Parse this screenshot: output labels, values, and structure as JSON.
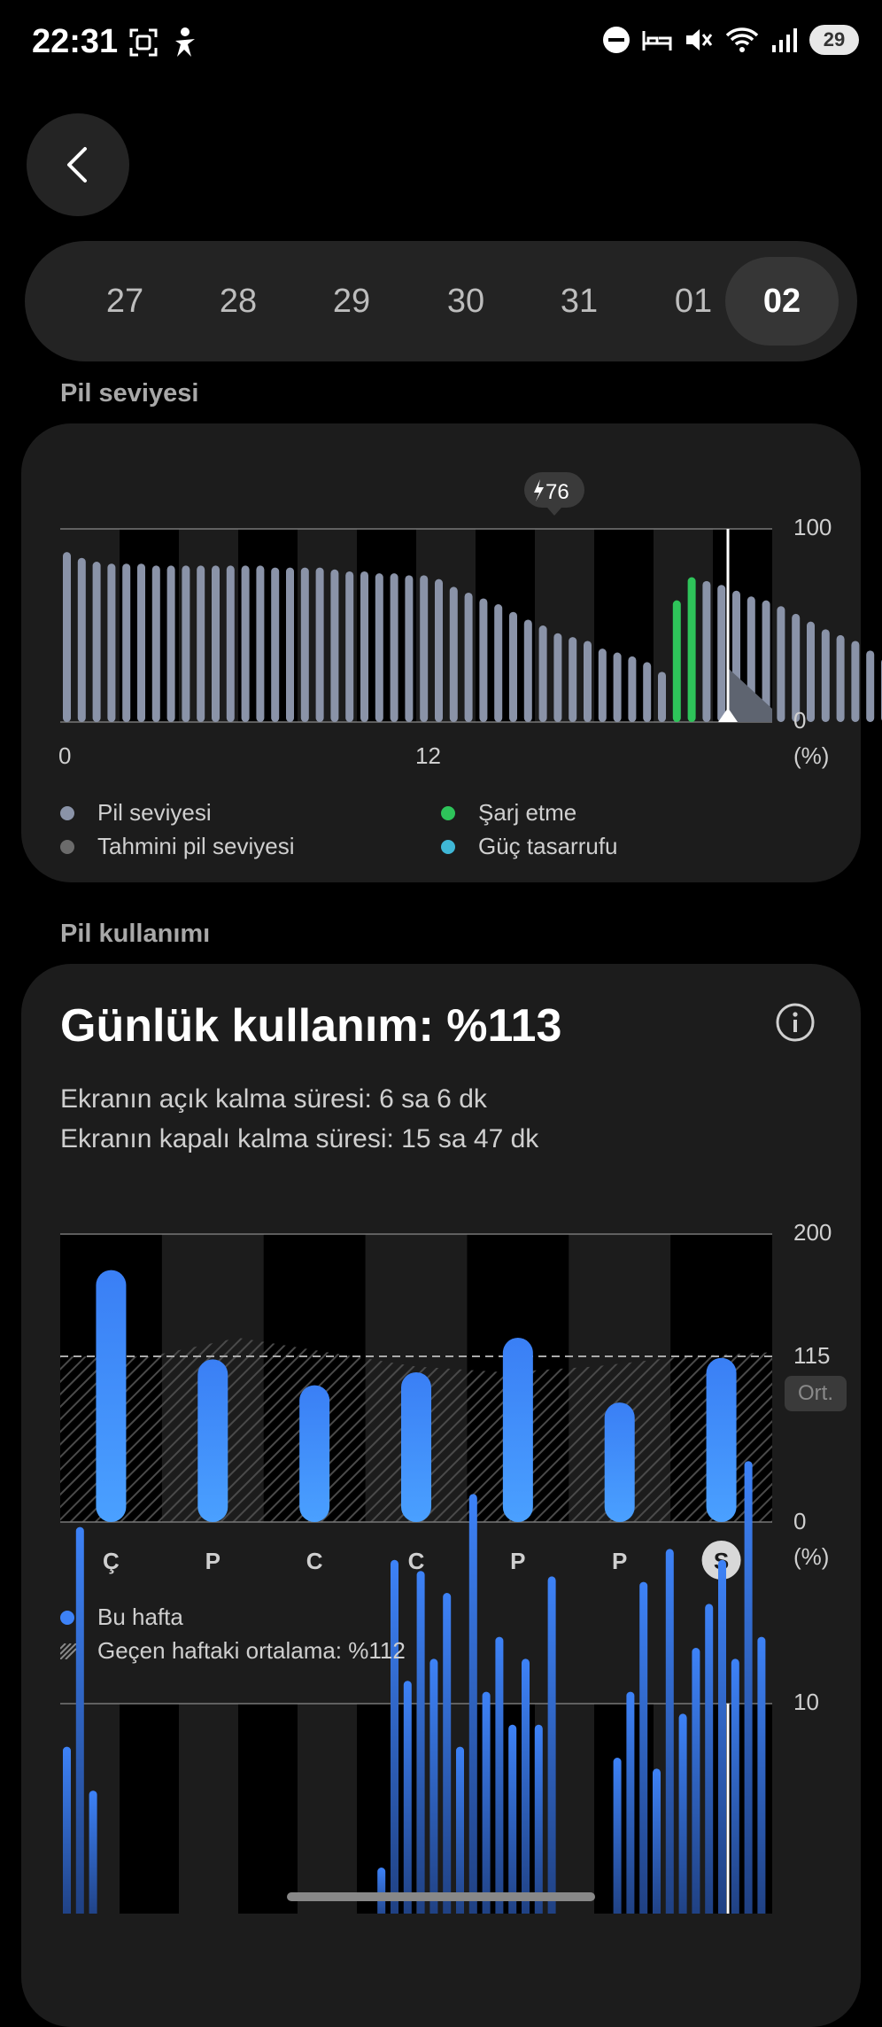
{
  "status_bar": {
    "time": "22:31",
    "battery": "29"
  },
  "nav": {
    "back_icon": "back-arrow-icon"
  },
  "dates": [
    "27",
    "28",
    "29",
    "30",
    "31",
    "01",
    "02"
  ],
  "selected_date": "02",
  "battery_level": {
    "section_label": "Pil seviyesi",
    "charge_badge": "76",
    "y_max_label": "100",
    "y_min_label": "0",
    "y_unit": "(%)",
    "x_labels": [
      "0",
      "12"
    ],
    "legend": [
      {
        "label": "Pil seviyesi",
        "color": "#8a93a8"
      },
      {
        "label": "Tahmini pil seviyesi",
        "color": "#6b6b6b"
      },
      {
        "label": "Şarj etme",
        "color": "#2ec45a"
      },
      {
        "label": "Güç tasarrufu",
        "color": "#3fb7d6"
      }
    ]
  },
  "chart_data": [
    {
      "type": "bar",
      "title": "",
      "ylabel": "(%)",
      "ylim": [
        0,
        100
      ],
      "x_ticks": [
        "0",
        "12"
      ],
      "series": [
        {
          "name": "Pil seviyesi",
          "color": "#8a93a8",
          "values": [
            88,
            85,
            83,
            82,
            82,
            82,
            81,
            81,
            81,
            81,
            81,
            81,
            81,
            81,
            80,
            80,
            80,
            80,
            79,
            78,
            78,
            77,
            77,
            76,
            76,
            74,
            70,
            67,
            64,
            61,
            57,
            53,
            50,
            46,
            44,
            42,
            38,
            36,
            34,
            31,
            26,
            0,
            0,
            73,
            71,
            68,
            65,
            63,
            60,
            56,
            52,
            48,
            45,
            42,
            37,
            33
          ]
        },
        {
          "name": "Şarj etme",
          "color": "#2ec45a",
          "values": [
            0,
            0,
            0,
            0,
            0,
            0,
            0,
            0,
            0,
            0,
            0,
            0,
            0,
            0,
            0,
            0,
            0,
            0,
            0,
            0,
            0,
            0,
            0,
            0,
            0,
            0,
            0,
            0,
            0,
            0,
            0,
            0,
            0,
            0,
            0,
            0,
            0,
            0,
            0,
            0,
            0,
            63,
            75,
            0,
            0,
            0,
            0,
            0,
            0,
            0,
            0,
            0,
            0,
            0,
            0,
            0
          ]
        }
      ]
    },
    {
      "type": "bar",
      "title": "Günlük kullanım: %113",
      "ylabel": "(%)",
      "ylim": [
        0,
        200
      ],
      "categories": [
        "Ç",
        "P",
        "C",
        "C",
        "P",
        "P",
        "S"
      ],
      "series": [
        {
          "name": "Bu hafta",
          "color": "#3d82f7",
          "values": [
            175,
            113,
            95,
            104,
            128,
            83,
            114
          ]
        }
      ],
      "average": 115,
      "previous_week_curve": [
        115,
        115,
        128,
        118,
        108,
        104,
        108,
        115,
        118
      ]
    },
    {
      "type": "bar",
      "ylim": [
        0,
        10
      ],
      "series": [
        {
          "name": "",
          "color": "#3d82f7",
          "values": [
            3.2,
            7.2,
            2.4,
            0,
            0,
            0,
            0,
            0,
            0,
            0,
            0,
            0,
            0,
            0,
            0,
            0,
            0,
            0,
            0,
            0,
            0,
            0,
            0,
            0,
            1,
            6.6,
            4.4,
            6.4,
            4.8,
            6,
            3.2,
            7.8,
            4.2,
            5.2,
            3.6,
            4.8,
            3.6,
            6.3,
            0,
            0,
            0,
            0,
            3,
            4.2,
            6.2,
            2.8,
            6.8,
            3.8,
            5,
            5.8,
            6.6,
            4.8,
            8.4,
            5.2
          ]
        }
      ]
    }
  ],
  "battery_usage": {
    "section_label": "Pil kullanımı",
    "title": "Günlük kullanım: %113",
    "screen_on": "Ekranın açık kalma süresi: 6 sa 6 dk",
    "screen_off": "Ekranın kapalı kalma süresi: 15 sa 47 dk",
    "y_labels": [
      "200",
      "115",
      "0"
    ],
    "avg_badge": "Ort.",
    "y_unit": "(%)",
    "legend_this_week": "Bu hafta",
    "legend_last_week": "Geçen haftaki ortalama: %112",
    "hourly_y_max": "10"
  }
}
